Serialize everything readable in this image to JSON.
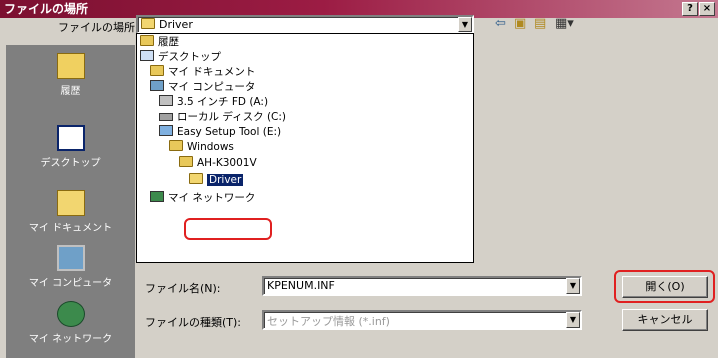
{
  "window": {
    "title": "ファイルの場所"
  },
  "titlebar_buttons": {
    "help": "?",
    "close": "×"
  },
  "lookin": {
    "label": "ファイルの場所(I):",
    "value": "Driver"
  },
  "dropdown": {
    "items": [
      {
        "label": "履歴",
        "icon": "history-folder-icon"
      },
      {
        "label": "デスクトップ",
        "icon": "desktop-icon"
      },
      {
        "label": "マイ ドキュメント",
        "icon": "my-documents-icon"
      },
      {
        "label": "マイ コンピュータ",
        "icon": "my-computer-icon"
      },
      {
        "label": "3.5 インチ FD (A:)",
        "icon": "floppy-drive-icon"
      },
      {
        "label": "ローカル ディスク (C:)",
        "icon": "local-disk-icon"
      },
      {
        "label": "Easy Setup Tool (E:)",
        "icon": "cd-drive-icon"
      },
      {
        "label": "Windows",
        "icon": "folder-icon"
      },
      {
        "label": "AH-K3001V",
        "icon": "folder-icon"
      },
      {
        "label": "Driver",
        "icon": "open-folder-icon",
        "selected": true
      },
      {
        "label": "マイ ネットワーク",
        "icon": "network-icon"
      }
    ]
  },
  "places": [
    {
      "label": "履歴",
      "icon": "history-icon"
    },
    {
      "label": "デスクトップ",
      "icon": "desktop-icon"
    },
    {
      "label": "マイ ドキュメント",
      "icon": "my-documents-icon"
    },
    {
      "label": "マイ コンピュータ",
      "icon": "my-computer-icon"
    },
    {
      "label": "マイ ネットワーク",
      "icon": "network-icon"
    }
  ],
  "filename": {
    "label": "ファイル名(N):",
    "value": "KPENUM.INF"
  },
  "filetype": {
    "label": "ファイルの種類(T):",
    "value": "セットアップ情報 (*.inf)"
  },
  "buttons": {
    "open": "開く(O)",
    "cancel": "キャンセル"
  },
  "colors": {
    "title_bar": "#9c1c44",
    "selection": "#0a246a",
    "highlight_ring": "#e02020"
  }
}
